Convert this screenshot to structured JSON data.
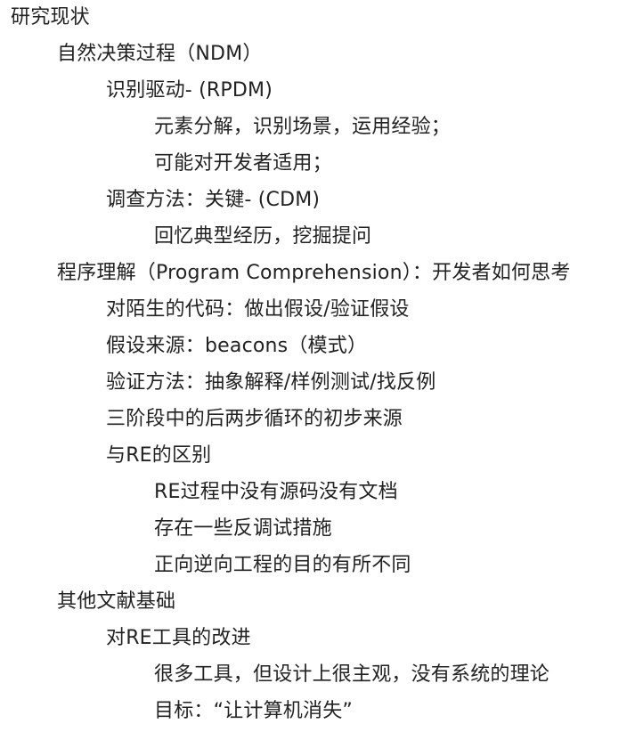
{
  "outline": [
    {
      "level": 0,
      "text": "研究现状"
    },
    {
      "level": 1,
      "text": "自然决策过程（NDM）"
    },
    {
      "level": 2,
      "text": "识别驱动- (RPDM)"
    },
    {
      "level": 3,
      "text": "元素分解，识别场景，运用经验；"
    },
    {
      "level": 3,
      "text": "可能对开发者适用；"
    },
    {
      "level": 2,
      "text": "调查方法：关键- (CDM)"
    },
    {
      "level": 3,
      "text": "回忆典型经历，挖掘提问"
    },
    {
      "level": 1,
      "text": "程序理解（Program Comprehension）：开发者如何思考"
    },
    {
      "level": 2,
      "text": "对陌生的代码：做出假设/验证假设"
    },
    {
      "level": 2,
      "text": "假设来源：beacons（模式）"
    },
    {
      "level": 2,
      "text": "验证方法：抽象解释/样例测试/找反例"
    },
    {
      "level": 2,
      "text": "三阶段中的后两步循环的初步来源"
    },
    {
      "level": 2,
      "text": "与RE的区别"
    },
    {
      "level": 3,
      "text": "RE过程中没有源码没有文档"
    },
    {
      "level": 3,
      "text": "存在一些反调试措施"
    },
    {
      "level": 3,
      "text": "正向逆向工程的目的有所不同"
    },
    {
      "level": 1,
      "text": "其他文献基础"
    },
    {
      "level": 2,
      "text": "对RE工具的改进"
    },
    {
      "level": 3,
      "text": "很多工具，但设计上很主观，没有系统的理论"
    },
    {
      "level": 3,
      "text": "目标：“让计算机消失”"
    }
  ]
}
